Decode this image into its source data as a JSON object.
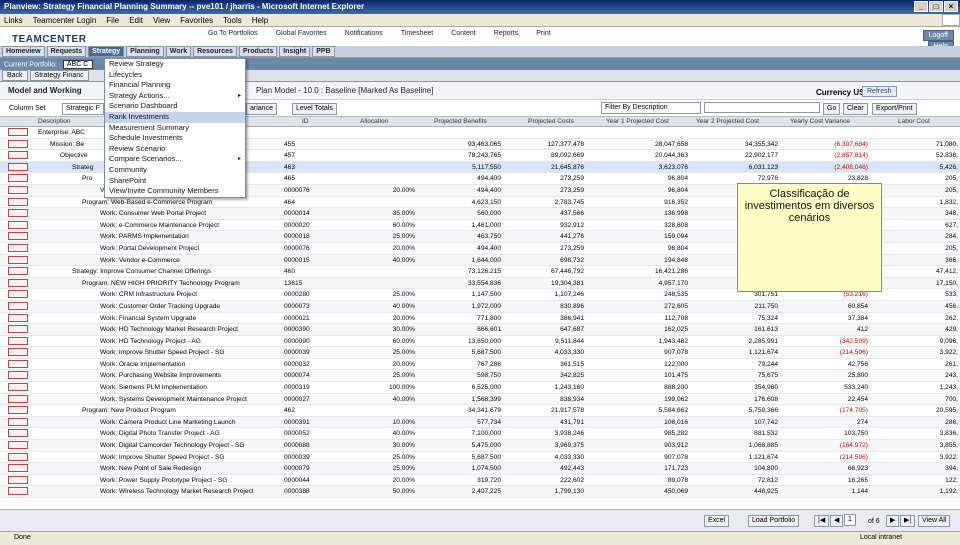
{
  "window": {
    "title": "Planview: Strategy Financial Planning Summary -- pve101 / jharris - Microsoft Internet Explorer"
  },
  "browser_menu": [
    "Links",
    "Teamcenter Login",
    "File",
    "Edit",
    "View",
    "Favorites",
    "Tools",
    "Help"
  ],
  "header": {
    "logo": "TEAMCENTER",
    "links": [
      "Go To Portfolios",
      "Global Favorites",
      "Notifications",
      "Timesheet",
      "Content",
      "Reports",
      "Print"
    ],
    "logoff": "Logoff",
    "help": "Help"
  },
  "nav": [
    "Homeview",
    "Requests",
    "Strategy",
    "Planning",
    "Work",
    "Resources",
    "Products",
    "Insight",
    "PPB"
  ],
  "portal": {
    "label": "Current Portfolio:",
    "value": "ABC C"
  },
  "tabs": [
    "Back",
    "Strategy Financ"
  ],
  "page": {
    "title": "Model and Working",
    "model": "Plan Model - 10.0 : Baseline [Marked As Baseline]",
    "currency": "Currency USD",
    "refresh": "Refresh"
  },
  "toolbar": {
    "column_set": "Column Set",
    "column_set_value": "Strategic F",
    "variance_btn": "ariance",
    "level_totals": "Level Totals",
    "filter": "Filter By Description",
    "go": "Go",
    "clear": "Clear",
    "export": "Export/Print"
  },
  "menu": [
    {
      "label": "Review Strategy"
    },
    {
      "label": "Lifecycles"
    },
    {
      "label": "Financial Planning"
    },
    {
      "label": "Strategy Actions...",
      "arrow": true
    },
    {
      "label": "Scenario Dashboard"
    },
    {
      "label": "Rank Investments",
      "highlight": true
    },
    {
      "label": "Measurement Summary"
    },
    {
      "label": "Schedule Investments"
    },
    {
      "label": "Review Scenario"
    },
    {
      "label": "Compare Scenarios...",
      "arrow": true
    },
    {
      "label": "Community"
    },
    {
      "label": "SharePoint"
    },
    {
      "label": "View/Invite Community Members"
    }
  ],
  "tooltip": "Classificação de investimentos em diversos cenários",
  "grid": {
    "headers": [
      "Description",
      "ID",
      "Allocation",
      "Projected Benefits",
      "Projected Costs",
      "Year 1 Projected Cost",
      "Year 2 Projected Cost",
      "Yearly Cost Variance",
      "Labor Cost"
    ],
    "rows": [
      {
        "d": "Enterprise: ABC",
        "id": "",
        "a": "",
        "pb": "",
        "pc": "",
        "y1": "",
        "y2": "",
        "v": "",
        "l": ""
      },
      {
        "d": "Mission: Be",
        "id": "455",
        "a": "",
        "pb": "93,463,065",
        "pc": "127,377,478",
        "y1": "28,047,658",
        "y2": "34,355,342",
        "v": "(6,307,684)",
        "l": "71,080,"
      },
      {
        "d": "Objective",
        "id": "457",
        "a": "",
        "pb": "78,243,765",
        "pc": "89,092,669",
        "y1": "20,044,363",
        "y2": "22,902,177",
        "v": "(2,857,814)",
        "l": "52,838,"
      },
      {
        "d": "Strateg",
        "id": "463",
        "a": "",
        "pb": "5,117,550",
        "pc": "21,645,876",
        "y1": "3,623,076",
        "y2": "6,031,123",
        "v": "(2,408,046)",
        "l": "5,426,"
      },
      {
        "d": "Pro",
        "id": "465",
        "a": "",
        "pb": "494,400",
        "pc": "273,259",
        "y1": "96,804",
        "y2": "72,976",
        "v": "23,828",
        "l": "205,"
      },
      {
        "d": "V",
        "id": "0000076",
        "a": "20.00%",
        "pb": "494,400",
        "pc": "273,259",
        "y1": "96,804",
        "y2": "",
        "v": "",
        "l": "205,"
      },
      {
        "d": "Program: Web-Based e-Commerce Program",
        "id": "464",
        "a": "",
        "pb": "4,623,150",
        "pc": "2,783,745",
        "y1": "916,352",
        "y2": "",
        "v": "",
        "l": "1,832,"
      },
      {
        "d": "Work: Consumer Web Portal Project",
        "id": "0000014",
        "a": "35.00%",
        "pb": "560,000",
        "pc": "437,566",
        "y1": "136,998",
        "y2": "",
        "v": "",
        "l": "348,"
      },
      {
        "d": "Work: e-Commerce Maintenance Project",
        "id": "0000020",
        "a": "60.00%",
        "pb": "1,461,000",
        "pc": "932,912",
        "y1": "328,608",
        "y2": "",
        "v": "",
        "l": "627,"
      },
      {
        "d": "Work: PARMS Implementation",
        "id": "0000018",
        "a": "25.00%",
        "pb": "463,750",
        "pc": "441,276",
        "y1": "159,094",
        "y2": "",
        "v": "",
        "l": "284,"
      },
      {
        "d": "Work: Portal Development Project",
        "id": "0000076",
        "a": "20.00%",
        "pb": "494,400",
        "pc": "273,259",
        "y1": "96,804",
        "y2": "",
        "v": "",
        "l": "205,"
      },
      {
        "d": "Work: Vendor e-Commerce",
        "id": "0000015",
        "a": "40.00%",
        "pb": "1,644,000",
        "pc": "698,732",
        "y1": "194,848",
        "y2": "",
        "v": "",
        "l": "366,"
      },
      {
        "d": "Strategy: Improve Consumer Channel Offerings",
        "id": "460",
        "a": "",
        "pb": "73,126,215",
        "pc": "67,446,792",
        "y1": "16,421,286",
        "y2": "",
        "v": "",
        "l": "47,412,"
      },
      {
        "d": "Program: NEW HIGH PRIORITY Technology Program",
        "id": "13615",
        "a": "",
        "pb": "33,554,836",
        "pc": "19,304,381",
        "y1": "4,957,170",
        "y2": "",
        "v": "",
        "l": "17,150,"
      },
      {
        "d": "Work: CRM Infrastructure Project",
        "id": "0000280",
        "a": "25.00%",
        "pb": "1,147,500",
        "pc": "1,107,246",
        "y1": "248,535",
        "y2": "301,751",
        "v": "(53,216)",
        "l": "533,"
      },
      {
        "d": "Work: Customer Order Tracking Upgrade",
        "id": "0000073",
        "a": "40.00%",
        "pb": "1,972,000",
        "pc": "830,896",
        "y1": "272,605",
        "y2": "211,750",
        "v": "60,854",
        "l": "456,"
      },
      {
        "d": "Work: Financial System Upgrade",
        "id": "0000021",
        "pb": "771,800",
        "a": "20.00%",
        "pc": "386,941",
        "y1": "112,708",
        "y2": "75,324",
        "v": "37,384",
        "l": "262,"
      },
      {
        "d": "Work: HD Technology Market Research Project",
        "id": "0000390",
        "a": "30.00%",
        "pb": "866,601",
        "pc": "647,687",
        "y1": "162,025",
        "y2": "161,613",
        "v": "412",
        "l": "429,"
      },
      {
        "d": "Work: HD Technology Project - AG",
        "id": "0000090",
        "a": "60.00%",
        "pb": "13,650,000",
        "pc": "9,511,844",
        "y1": "1,943,482",
        "y2": "2,285,991",
        "v": "(342,509)",
        "l": "9,096,"
      },
      {
        "d": "Work: Improve Shutter Speed Project - SG",
        "id": "0000039",
        "a": "25.00%",
        "pb": "5,687,500",
        "pc": "4,033,330",
        "y1": "907,078",
        "y2": "1,121,674",
        "v": "(214,596)",
        "l": "3,922,"
      },
      {
        "d": "Work: Oracle Implementation",
        "id": "0000032",
        "a": "20.00%",
        "pb": "767,286",
        "pc": "361,515",
        "y1": "122,000",
        "y2": "79,244",
        "v": "42,756",
        "l": "261,"
      },
      {
        "d": "Work: Purchasing Website Improvements",
        "id": "0000074",
        "a": "25.00%",
        "pb": "598,750",
        "pc": "342,825",
        "y1": "101,475",
        "y2": "75,675",
        "v": "25,800",
        "l": "243,"
      },
      {
        "d": "Work: Siemens PLM Implementation",
        "id": "0000319",
        "a": "100.00%",
        "pb": "6,525,000",
        "pc": "1,243,160",
        "y1": "888,200",
        "y2": "354,960",
        "v": "533,240",
        "l": "1,243,"
      },
      {
        "d": "Work: Systems Development Maintenance Project",
        "id": "0000027",
        "a": "40.00%",
        "pb": "1,568,399",
        "pc": "838,934",
        "y1": "199,062",
        "y2": "176,608",
        "v": "22,454",
        "l": "700,"
      },
      {
        "d": "Program: New Product Program",
        "id": "462",
        "a": "",
        "pb": "34,341,679",
        "pc": "21,917,578",
        "y1": "5,584,662",
        "y2": "5,759,366",
        "v": "(174,705)",
        "l": "20,595,"
      },
      {
        "d": "Work: Camera Product Line Marketing Launch",
        "id": "0000391",
        "a": "10.00%",
        "pb": "577,734",
        "pc": "431,791",
        "y1": "108,016",
        "y2": "107,742",
        "v": "274",
        "l": "286,"
      },
      {
        "d": "Work: Digital Photo Transfer Project - AG",
        "id": "0000052",
        "a": "40.00%",
        "pb": "7,100,000",
        "pc": "3,938,246",
        "y1": "985,282",
        "y2": "881,532",
        "v": "103,750",
        "l": "3,836,"
      },
      {
        "d": "Work: Digital Camcorder Technology Project - SG",
        "id": "0000088",
        "a": "30.00%",
        "pb": "5,475,000",
        "pc": "3,969,375",
        "y1": "903,912",
        "y2": "1,068,885",
        "v": "(164,972)",
        "l": "3,855,"
      },
      {
        "d": "Work: Improve Shutter Speed Project - SG",
        "id": "0000039",
        "a": "25.00%",
        "pb": "5,687,500",
        "pc": "4,033,330",
        "y1": "907,078",
        "y2": "1,121,674",
        "v": "(214,596)",
        "l": "3,922,"
      },
      {
        "d": "Work: New Point of Sale Redesign",
        "id": "0000079",
        "a": "25.00%",
        "pb": "1,074,500",
        "pc": "492,443",
        "y1": "171,723",
        "y2": "104,800",
        "v": "66,923",
        "l": "394,"
      },
      {
        "d": "Work: Power Supply Prototype Project - SG",
        "id": "0000044",
        "a": "20.00%",
        "pb": "319,720",
        "pc": "222,602",
        "y1": "89,078",
        "y2": "72,812",
        "v": "16,265",
        "l": "122,"
      },
      {
        "d": "Work: Wireless Technology Market Research Project",
        "id": "0000388",
        "a": "50.00%",
        "pb": "2,407,225",
        "pc": "1,799,130",
        "y1": "450,069",
        "y2": "448,925",
        "v": "1,144",
        "l": "1,192,"
      }
    ]
  },
  "footer": {
    "excel": "Excel",
    "load": "Load Portfolio",
    "page": "1",
    "of": "of 6",
    "viewall": "View All"
  },
  "status": {
    "left": "Done",
    "right": "Local intranet"
  }
}
